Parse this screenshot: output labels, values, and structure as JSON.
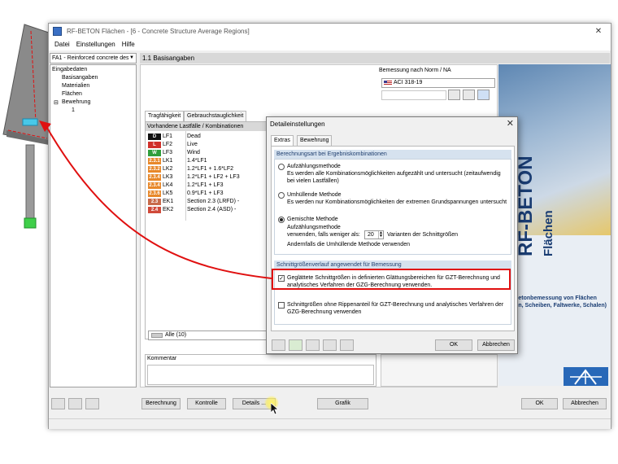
{
  "window": {
    "title": "RF-BETON Flächen - [6 - Concrete Structure Average Regions]",
    "minimize": "—",
    "close": "✕"
  },
  "menu": [
    "Datei",
    "Einstellungen",
    "Hilfe"
  ],
  "case_combo": "FA1 - Reinforced concrete desi",
  "nav": {
    "root": "Eingabedaten",
    "items": [
      "Basisangaben",
      "Materialien",
      "Flächen"
    ],
    "group": "Bewehrung",
    "sub": "1"
  },
  "section_title": "1.1 Basisangaben",
  "norm": {
    "label": "Bemessung nach Norm / NA",
    "value": "ACI 318-19"
  },
  "tabs": [
    "Tragfähigkeit",
    "Gebrauchstauglichkeit"
  ],
  "load_cases": {
    "header": "Vorhandene Lastfälle / Kombinationen",
    "rows": [
      {
        "badge": "D",
        "color": "#111111",
        "code": "LF1",
        "desc": "Dead"
      },
      {
        "badge": "L",
        "color": "#d0302a",
        "code": "LF2",
        "desc": "Live"
      },
      {
        "badge": "W",
        "color": "#2f9e3c",
        "code": "LF3",
        "desc": "Wind"
      },
      {
        "badge": "2.3.1",
        "color": "#e8882a",
        "code": "LK1",
        "desc": "1.4*LF1"
      },
      {
        "badge": "2.3.2",
        "color": "#e8882a",
        "code": "LK2",
        "desc": "1.2*LF1 + 1.6*LF2"
      },
      {
        "badge": "2.3.4",
        "color": "#e8882a",
        "code": "LK3",
        "desc": "1.2*LF1 + LF2 + LF3"
      },
      {
        "badge": "2.3.4",
        "color": "#e8882a",
        "code": "LK4",
        "desc": "1.2*LF1 + LF3"
      },
      {
        "badge": "2.3.6",
        "color": "#e8882a",
        "code": "LK5",
        "desc": "0.9*LF1 + LF3"
      },
      {
        "badge": "2.3",
        "color": "#c86a4a",
        "code": "EK1",
        "desc": "Section 2.3 (LRFD) -"
      },
      {
        "badge": "2.4",
        "color": "#d04a3a",
        "code": "EK2",
        "desc": "Section 2.4 (ASD) -"
      }
    ],
    "filter": "Alle (10)"
  },
  "comment_label": "Kommentar",
  "bottom_buttons": {
    "berechnung": "Berechnung",
    "kontrolle": "Kontrolle",
    "details": "Details ...",
    "grafik": "Grafik",
    "ok": "OK",
    "abbrechen": "Abbrechen"
  },
  "splash": {
    "brand": "RF-BETON",
    "brand_sub": "Flächen",
    "caption": "Stahlbetonbemessung von Flächen (Platten, Scheiben, Faltwerke, Schalen)"
  },
  "dialog": {
    "title": "Detaileinstellungen",
    "close": "✕",
    "tabs": [
      "Extras",
      "Bewehrung"
    ],
    "group1": "Berechnungsart bei Ergebniskombinationen",
    "opt1_title": "Aufzählungsmethode",
    "opt1_desc": "Es werden alle Kombinationsmöglichkeiten aufgezählt und untersucht (zeitaufwendig bei vielen Lastfällen)",
    "opt2_title": "Umhüllende Methode",
    "opt2_desc": "Es werden nur Kombinationsmöglichkeiten der extremen Grundspannungen untersucht",
    "opt3_title": "Gemischte Methode",
    "opt3_sub": "Aufzählungsmethode",
    "opt3_prefix": "verwenden, falls weniger als:",
    "opt3_value": "20",
    "opt3_suffix": "Varianten der Schnittgrößen",
    "opt3_else": "Andernfalls die Umhüllende Methode verwenden",
    "group2": "Schnittgrößenverlauf angewendet für Bemessung",
    "chk1": "Geglättete Schnittgrößen in definierten Glättungsbereichen für GZT-Berechnung und analytisches Verfahren der GZG-Berechnung verwenden.",
    "chk2": "Schnittgrößen ohne Rippenanteil für GZT-Berechnung und analytisches Verfahren der GZG-Berechnung verwenden",
    "ok": "OK",
    "abbrechen": "Abbrechen"
  },
  "colors": {
    "highlight": "#e01010",
    "accent": "#1a3d73",
    "arrow": "#e01010"
  }
}
